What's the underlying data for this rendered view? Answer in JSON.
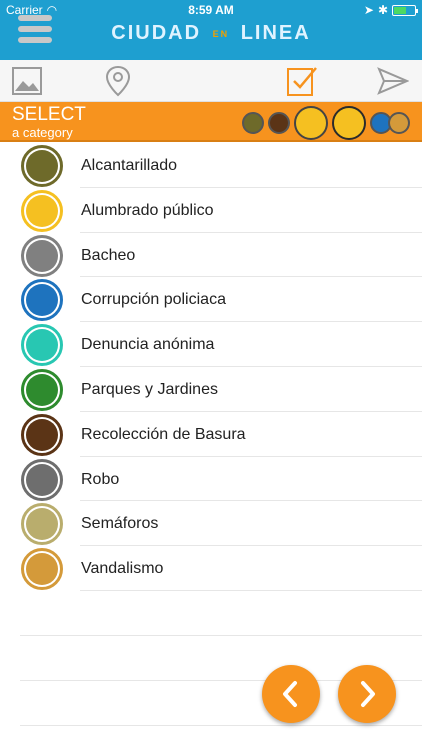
{
  "status": {
    "carrier": "Carrier",
    "time": "8:59 AM"
  },
  "header": {
    "title_left": "CIUDAD",
    "title_mid": "EN",
    "title_right": "LINEA"
  },
  "toolbar": {
    "items": [
      "image-icon",
      "location-icon",
      "checklist-icon",
      "send-icon"
    ]
  },
  "select": {
    "title": "SELECT",
    "subtitle": "a category"
  },
  "categories": [
    {
      "label": "Alcantarillado",
      "color": "#6e6a2a"
    },
    {
      "label": "Alumbrado público",
      "color": "#f5c021"
    },
    {
      "label": "Bacheo",
      "color": "#808080"
    },
    {
      "label": "Corrupción policiaca",
      "color": "#1e73be"
    },
    {
      "label": "Denuncia anónima",
      "color": "#28c7b2"
    },
    {
      "label": "Parques y Jardines",
      "color": "#2e8b2e"
    },
    {
      "label": "Recolección de Basura",
      "color": "#5b3416"
    },
    {
      "label": "Robo",
      "color": "#6e6e6e"
    },
    {
      "label": "Semáforos",
      "color": "#b9ad6d"
    },
    {
      "label": "Vandalismo",
      "color": "#d49a3a"
    }
  ],
  "colors": {
    "header": "#1e9fd0",
    "accent": "#f7931e"
  }
}
